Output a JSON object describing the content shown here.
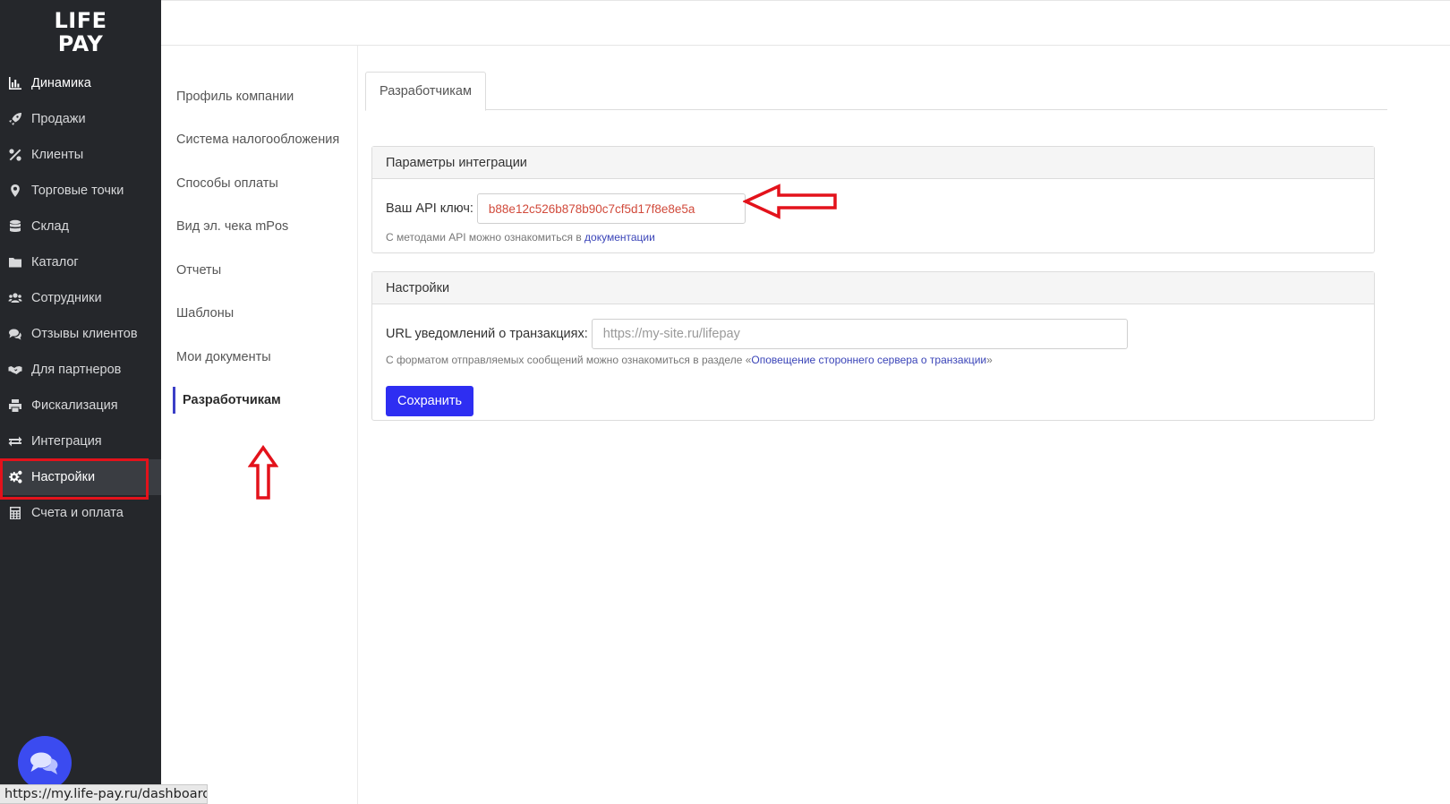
{
  "brand": {
    "logo_line1": "LIFE",
    "logo_line2": "PAY"
  },
  "sidebar": {
    "items": [
      {
        "label": "Динамика",
        "icon": "bar-chart-icon"
      },
      {
        "label": "Продажи",
        "icon": "rocket-icon"
      },
      {
        "label": "Клиенты",
        "icon": "percent-icon"
      },
      {
        "label": "Торговые точки",
        "icon": "map-marker-icon"
      },
      {
        "label": "Склад",
        "icon": "database-icon"
      },
      {
        "label": "Каталог",
        "icon": "folder-icon"
      },
      {
        "label": "Сотрудники",
        "icon": "users-icon"
      },
      {
        "label": "Отзывы клиентов",
        "icon": "comments-icon"
      },
      {
        "label": "Для партнеров",
        "icon": "handshake-icon"
      },
      {
        "label": "Фискализация",
        "icon": "printer-icon"
      },
      {
        "label": "Интеграция",
        "icon": "exchange-icon"
      },
      {
        "label": "Настройки",
        "icon": "gears-icon",
        "active": true
      },
      {
        "label": "Счета и оплата",
        "icon": "calculator-icon"
      }
    ]
  },
  "settings_menu": {
    "items": [
      {
        "label": "Профиль компании"
      },
      {
        "label": "Система налогообложения"
      },
      {
        "label": "Способы оплаты"
      },
      {
        "label": "Вид эл. чека mPos"
      },
      {
        "label": "Отчеты"
      },
      {
        "label": "Шаблоны"
      },
      {
        "label": "Мои документы"
      },
      {
        "label": "Разработчикам",
        "active": true
      }
    ]
  },
  "tabs": [
    {
      "label": "Разработчикам"
    }
  ],
  "integration_panel": {
    "heading": "Параметры интеграции",
    "api_key_label": "Ваш API ключ:",
    "api_key_value": "b88e12c526b878b90c7cf5d17f8e8e5a",
    "help_prefix": "С методами API можно ознакомиться в ",
    "help_link": "документации"
  },
  "settings_panel": {
    "heading": "Настройки",
    "url_label": "URL уведомлений о транзакциях:",
    "url_placeholder": "https://my-site.ru/lifepay",
    "help_prefix": "С форматом отправляемых сообщений можно ознакомиться в разделе «",
    "help_link": "Оповещение стороннего сервера о транзакции",
    "help_suffix": "»",
    "save_label": "Сохранить"
  },
  "status_bar": {
    "url": "https://my.life-pay.ru/dashboard"
  },
  "colors": {
    "sidebar_bg": "#25272b",
    "accent_blue": "#2e2ef2",
    "highlight_red": "#e3121b",
    "api_key_text": "#d14a3b"
  }
}
